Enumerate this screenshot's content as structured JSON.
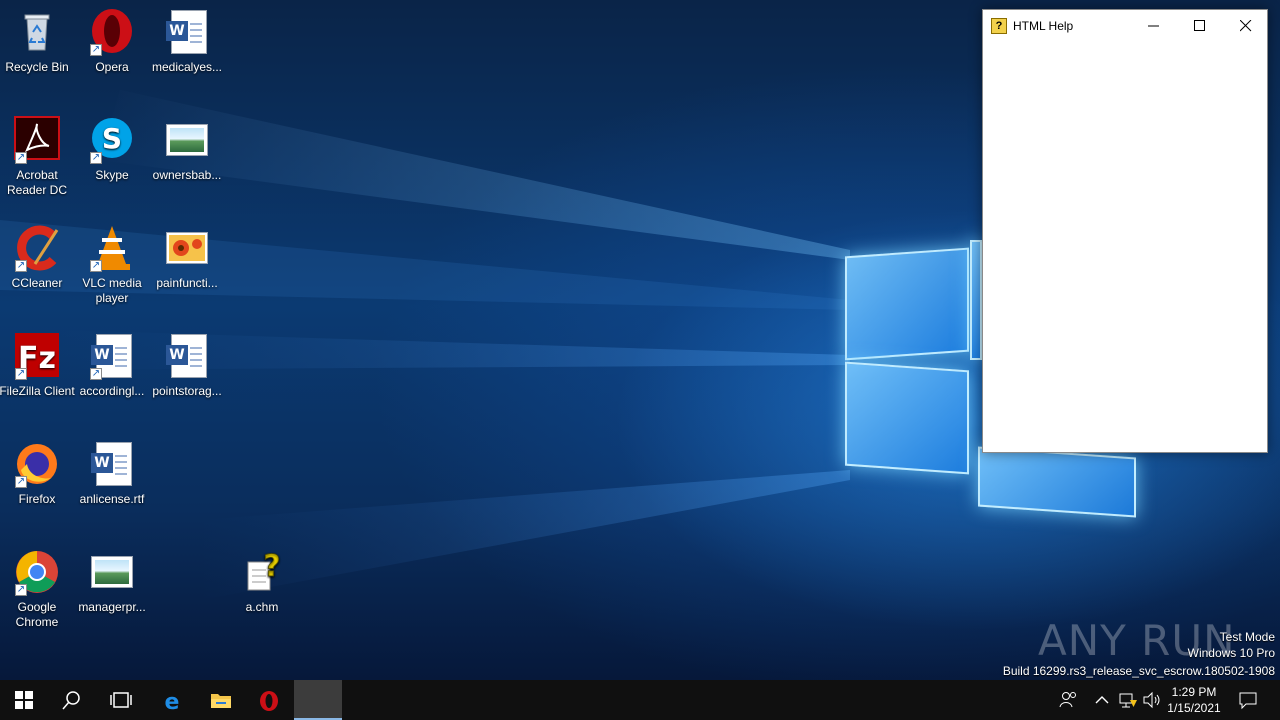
{
  "desktop": {
    "icons": [
      {
        "label": "Recycle Bin",
        "icon": "recycle-bin-icon"
      },
      {
        "label": "Opera",
        "icon": "opera-icon"
      },
      {
        "label": "medicalyes...",
        "icon": "word-document-icon"
      },
      {
        "label": "Acrobat Reader DC",
        "icon": "acrobat-reader-icon"
      },
      {
        "label": "Skype",
        "icon": "skype-icon"
      },
      {
        "label": "ownersbab...",
        "icon": "image-file-icon"
      },
      {
        "label": "CCleaner",
        "icon": "ccleaner-icon"
      },
      {
        "label": "VLC media player",
        "icon": "vlc-icon"
      },
      {
        "label": "painfuncti...",
        "icon": "image-file-icon"
      },
      {
        "label": "FileZilla Client",
        "icon": "filezilla-icon"
      },
      {
        "label": "accordingl...",
        "icon": "word-document-icon"
      },
      {
        "label": "pointstorag...",
        "icon": "word-document-icon"
      },
      {
        "label": "Firefox",
        "icon": "firefox-icon"
      },
      {
        "label": "anlicense.rtf",
        "icon": "word-document-icon"
      },
      {
        "label": "Google Chrome",
        "icon": "chrome-icon"
      },
      {
        "label": "managerpr...",
        "icon": "image-file-icon"
      },
      {
        "label": "a.chm",
        "icon": "chm-help-file-icon"
      }
    ]
  },
  "help_window": {
    "title": "HTML Help",
    "minimize_icon": "minimize-icon",
    "maximize_icon": "maximize-icon",
    "close_icon": "close-icon"
  },
  "watermark": {
    "logo_text": "ANY RUN",
    "line1": "Test Mode",
    "line2": "Windows 10 Pro",
    "line3": "Build 16299.rs3_release_svc_escrow.180502-1908"
  },
  "taskbar": {
    "buttons": [
      "start-icon",
      "search-icon",
      "task-view-icon",
      "edge-icon",
      "file-explorer-icon",
      "opera-icon"
    ],
    "tray_icons": [
      "people-icon",
      "chevron-up-icon",
      "network-icon",
      "volume-icon",
      "action-center-icon"
    ],
    "clock_time": "1:29 PM",
    "clock_date": "1/15/2021"
  },
  "colors": {
    "taskbar": "#101010",
    "desktop_blue": "#0b3a72",
    "opera_red": "#cc0f16",
    "word_blue": "#2b5797"
  }
}
